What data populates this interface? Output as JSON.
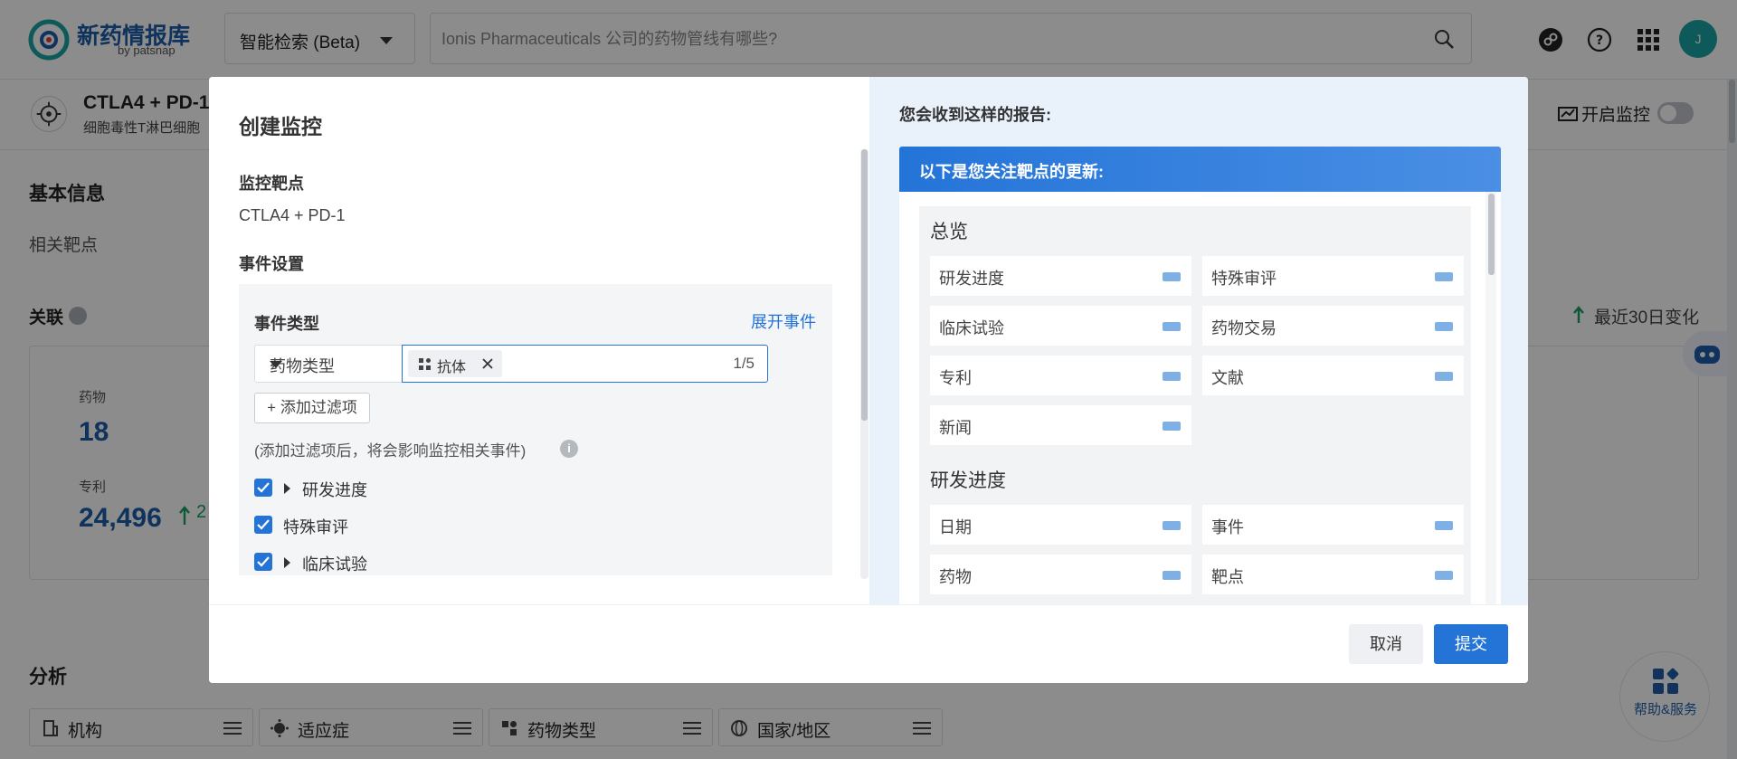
{
  "app": {
    "logo_text": "新药情报库",
    "logo_sub": "by patsnap",
    "search_mode": "智能检索 (Beta)",
    "search_placeholder": "Ionis Pharmaceuticals 公司的药物管线有哪些?",
    "avatar_letter": "J"
  },
  "subheader": {
    "title": "CTLA4 + PD-1",
    "desc": "细胞毒性T淋巴细胞",
    "monitor_label": "开启监控"
  },
  "background": {
    "basic_info": "基本信息",
    "related_targets": "相关靶点",
    "related": "关联",
    "change_label": "最近30日变化",
    "drug_label": "药物",
    "drug_count": "18",
    "patent_label": "专利",
    "patent_count": "24,496",
    "patent_change": "2",
    "analysis": "分析",
    "chips": [
      "机构",
      "适应症",
      "药物类型",
      "国家/地区"
    ],
    "help_label": "帮助&服务"
  },
  "modal": {
    "title": "创建监控",
    "target_heading": "监控靶点",
    "target_value": "CTLA4 + PD-1",
    "event_heading": "事件设置",
    "event_type_label": "事件类型",
    "expand_label": "展开事件",
    "type_select_value": "药物类型",
    "tag_label": "抗体",
    "tag_count": "1/5",
    "add_filter_label": "+ 添加过滤项",
    "filter_note": "(添加过滤项后，将会影响监控相关事件)",
    "events": [
      {
        "label": "研发进度",
        "checked": true,
        "expandable": true
      },
      {
        "label": "特殊审评",
        "checked": true,
        "expandable": false
      },
      {
        "label": "临床试验",
        "checked": true,
        "expandable": true
      }
    ],
    "preview_title": "您会收到这样的报告:",
    "preview_bar": "以下是您关注靶点的更新:",
    "overview_title": "总览",
    "overview_items": [
      "研发进度",
      "特殊审评",
      "临床试验",
      "药物交易",
      "专利",
      "文献",
      "新闻"
    ],
    "progress_title": "研发进度",
    "progress_items": [
      "日期",
      "事件",
      "药物",
      "靶点"
    ],
    "cancel_label": "取消",
    "submit_label": "提交"
  },
  "colors": {
    "primary": "#2474d8",
    "brand": "#1d5ea8",
    "overlay": "rgba(0,0,0,0.45)"
  }
}
